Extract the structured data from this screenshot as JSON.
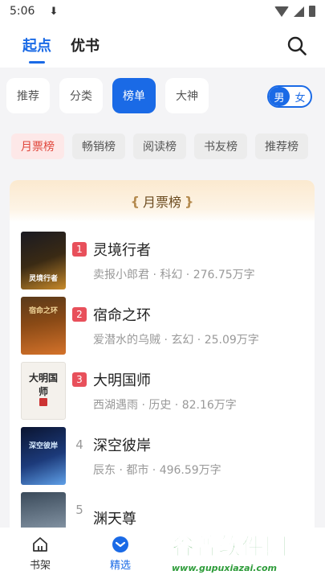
{
  "status": {
    "time": "5:06",
    "download_icon": "download-icon"
  },
  "top_tabs": [
    {
      "label": "起点",
      "active": true
    },
    {
      "label": "优书",
      "active": false
    }
  ],
  "categories": [
    {
      "label": "推荐",
      "active": false
    },
    {
      "label": "分类",
      "active": false
    },
    {
      "label": "榜单",
      "active": true
    },
    {
      "label": "大神",
      "active": false
    }
  ],
  "gender": {
    "male": "男",
    "female": "女",
    "selected": "男"
  },
  "rank_tabs": [
    {
      "label": "月票榜",
      "active": true
    },
    {
      "label": "畅销榜",
      "active": false
    },
    {
      "label": "阅读榜",
      "active": false
    },
    {
      "label": "书友榜",
      "active": false
    },
    {
      "label": "推荐榜",
      "active": false
    }
  ],
  "board": {
    "title": "月票榜",
    "books": [
      {
        "rank": "1",
        "title": "灵境行者",
        "meta": "卖报小郎君 · 科幻 · 276.75万字",
        "cover_text": "灵境行者"
      },
      {
        "rank": "2",
        "title": "宿命之环",
        "meta": "爱潜水的乌贼 · 玄幻 · 25.09万字",
        "cover_text": "宿命之环"
      },
      {
        "rank": "3",
        "title": "大明国师",
        "meta": "西湖遇雨 · 历史 · 82.16万字",
        "cover_text": "大明国师"
      },
      {
        "rank": "4",
        "title": "深空彼岸",
        "meta": "辰东 · 都市 · 496.59万字",
        "cover_text": "深空彼岸"
      },
      {
        "rank": "5",
        "title": "渊天尊",
        "meta": "",
        "cover_text": ""
      }
    ]
  },
  "bottom_nav": [
    {
      "label": "书架",
      "active": false
    },
    {
      "label": "精选",
      "active": true
    }
  ],
  "watermark": {
    "title": "谷普软件园",
    "url": "www.gupuxiazai.com"
  },
  "colors": {
    "accent": "#1a6ae6",
    "rank_red": "#e8505b",
    "chip_active_text": "#e0453a"
  }
}
